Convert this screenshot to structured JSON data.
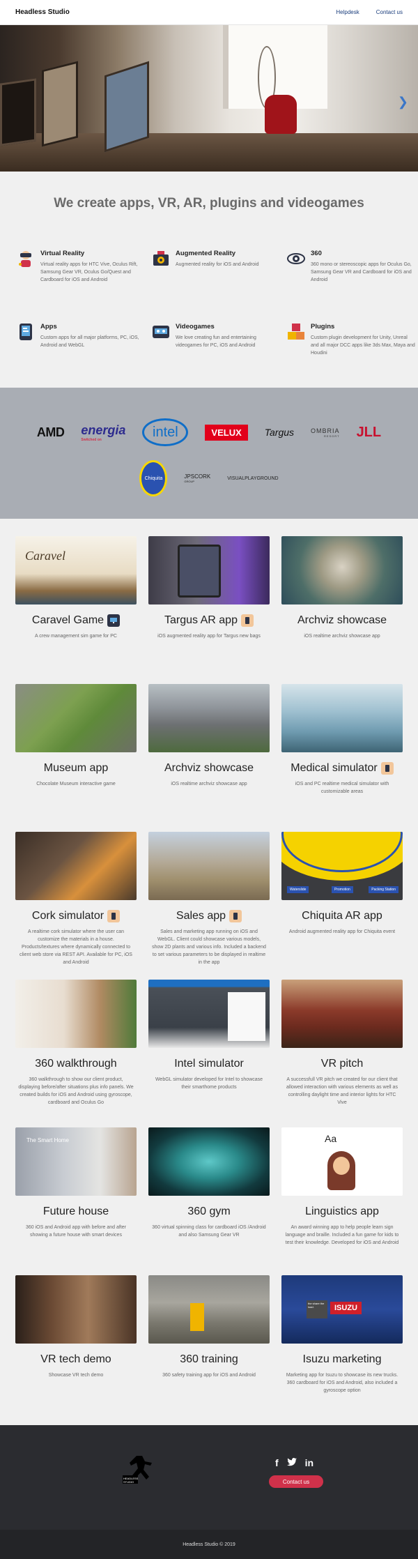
{
  "nav": {
    "brand": "Headless Studio",
    "links": [
      "Helpdesk",
      "Contact us"
    ]
  },
  "hero": {
    "next_icon": "chevron-right-icon"
  },
  "tagline": "We create apps, VR, AR, plugins and videogames",
  "services": [
    {
      "title": "Virtual Reality",
      "desc": "Virtual reality apps for HTC Vive, Oculus Rift, Samsung Gear VR, Oculus Go/Quest and Cardboard for iOS and Android",
      "icon": "vr-headset-icon"
    },
    {
      "title": "Augmented Reality",
      "desc": "Augmented reality for iOS and Android",
      "icon": "ar-target-icon"
    },
    {
      "title": "360",
      "desc": "360 mono or stereoscopic apps for Oculus Go, Samsung Gear VR and Cardboard for iOS and Android",
      "icon": "eye-icon"
    },
    {
      "title": "Apps",
      "desc": "Custom apps for all major platforms, PC, iOS, Android and WebGL",
      "icon": "phone-icon"
    },
    {
      "title": "Videogames",
      "desc": "We love creating fun and entertaining videogames for PC, iOS and Android",
      "icon": "gamepad-icon"
    },
    {
      "title": "Plugins",
      "desc": "Custom plugin development for Unity, Unreal and all major DCC apps like 3ds Max, Maya and Houdini",
      "icon": "cubes-icon"
    }
  ],
  "clients": {
    "row1": [
      "AMD",
      "energia",
      "intel",
      "VELUX",
      "Targus",
      "OMBRIA",
      "JLL"
    ],
    "row2": [
      "Chiquita",
      "JPSCORK",
      "VISUALPLAYGROUND"
    ],
    "energia_sub": "Switched on",
    "ombria_sub": "RESORT",
    "jps_sub": "GROUP"
  },
  "projects": [
    {
      "title": "Caravel Game",
      "desc": "A crew management sim game for PC",
      "badge": true,
      "img_text": "Caravel"
    },
    {
      "title": "Targus AR app",
      "desc": "iOS augmented reality app for Targus new bags",
      "badge": true
    },
    {
      "title": "Archviz showcase",
      "desc": "iOS realtime archviz showcase app",
      "badge": false
    },
    {
      "title": "Museum app",
      "desc": "Chocolate Museum interactive game",
      "badge": false
    },
    {
      "title": "Archviz showcase",
      "desc": "iOS realtime archviz showcase app",
      "badge": false
    },
    {
      "title": "Medical simulator",
      "desc": "iOS and PC realtime medical simulator with customizable areas",
      "badge": true
    },
    {
      "title": "Cork simulator",
      "desc": "A realtime cork simulator where the user can customize the materials in a house. Products/textures where dynamically connected to client web store via REST API. Available for PC, iOS and Android",
      "badge": true
    },
    {
      "title": "Sales app",
      "desc": "Sales and marketing app running on iOS and WebGL. Client could showcase various models, show 2D plants and various info. Included a backend to set various parameters to be displayed in realtime in the app",
      "badge": true
    },
    {
      "title": "Chiquita AR app",
      "desc": "Android augmented reality app for Chiquita event",
      "badge": false,
      "img_labels": [
        "Waterslide",
        "Promotion",
        "Packing Station"
      ]
    },
    {
      "title": "360 walkthrough",
      "desc": "360 walkthrough to show our client product, displaying before/after situations plus info panels. We created builds for iOS and Android using gyroscope, cardboard and Oculus Go",
      "badge": false
    },
    {
      "title": "Intel simulator",
      "desc": "WebGL simulator developed for Intel to showcase their smarthome products",
      "badge": false
    },
    {
      "title": "VR pitch",
      "desc": "A successfull VR pitch we created for our client that allowed interaction with various elements as well as controlling daylight time and interior lights for HTC Vive",
      "badge": false
    },
    {
      "title": "Future house",
      "desc": "360 iOS and Android app with before and after showing a future house with smart devices",
      "badge": false,
      "img_text": "The Smart Home"
    },
    {
      "title": "360 gym",
      "desc": "360 virtual spinning class for cardboard iOS /Android and also Samsung Gear VR",
      "badge": false
    },
    {
      "title": "Linguistics app",
      "desc": "An award winning app to help people learn sign language and braille. Included a fun game for kids to test their knowledge. Developed for iOS and Android",
      "badge": false,
      "img_text": "Aa"
    },
    {
      "title": "VR tech demo",
      "desc": "Showcase VR tech demo",
      "badge": false
    },
    {
      "title": "360 training",
      "desc": "360 safety training app for iOS and Android",
      "badge": false
    },
    {
      "title": "Isuzu marketing",
      "desc": "Marketing app for Isuzu to showcase its new trucks. 360 cardboard for iOS and Android, also included a gyroscope option",
      "badge": false,
      "img_text": "ISUZU",
      "img_text2": "the share the load."
    }
  ],
  "footer": {
    "logo_text": "HEADLESS\nSTUDIO",
    "social": [
      "f",
      "t",
      "in"
    ],
    "contact_label": "Contact us",
    "copyright": "Headless Studio © 2019"
  }
}
